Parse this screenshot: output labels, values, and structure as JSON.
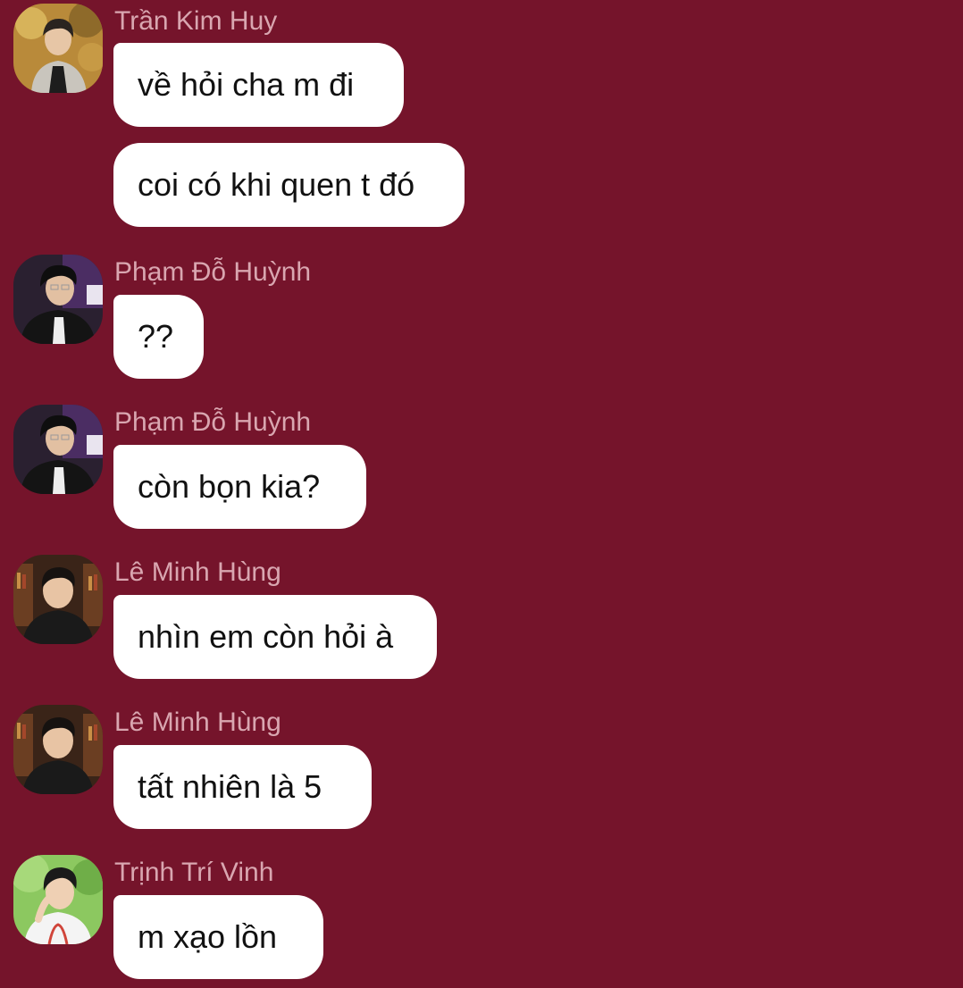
{
  "messages": [
    {
      "sender": "Trần Kim Huy",
      "avatar_icon": "user-avatar-tran-kim-huy",
      "texts": [
        "về hỏi cha m đi",
        "coi có khi quen t đó"
      ]
    },
    {
      "sender": "Phạm Đỗ Huỳnh",
      "avatar_icon": "user-avatar-pham-do-huynh",
      "texts": [
        "??"
      ]
    },
    {
      "sender": "Phạm Đỗ Huỳnh",
      "avatar_icon": "user-avatar-pham-do-huynh",
      "texts": [
        "còn bọn kia?"
      ]
    },
    {
      "sender": "Lê Minh Hùng",
      "avatar_icon": "user-avatar-le-minh-hung",
      "texts": [
        "nhìn em còn hỏi à"
      ]
    },
    {
      "sender": "Lê Minh Hùng",
      "avatar_icon": "user-avatar-le-minh-hung",
      "texts": [
        "tất nhiên là 5"
      ]
    },
    {
      "sender": "Trịnh Trí Vinh",
      "avatar_icon": "user-avatar-trinh-tri-vinh",
      "texts": [
        "m xạo lồn"
      ]
    }
  ],
  "colors": {
    "background": "#75142b",
    "bubble": "#ffffff",
    "sender_name": "#d9a6b0",
    "message_text": "#111111"
  }
}
